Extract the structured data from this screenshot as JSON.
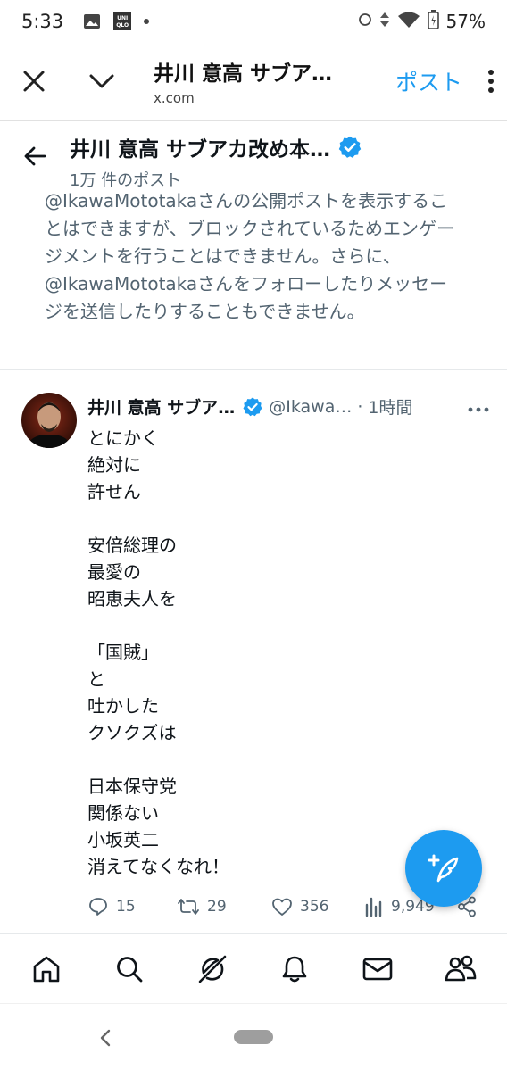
{
  "status_bar": {
    "time": "5:33",
    "uniqlo_label": "UNI QLO",
    "battery_percent": "57%"
  },
  "browser": {
    "title": "井川 意高 サブア…",
    "url": "x.com",
    "post_button": "ポスト"
  },
  "profile": {
    "name": "井川 意高 サブアカ改め本…",
    "post_count": "1万 件のポスト",
    "verified": true
  },
  "notice": "@IkawaMototakaさんの公開ポストを表示することはできますが、ブロックされているためエンゲージメントを行うことはできません。さらに、@IkawaMototakaさんをフォローしたりメッセージを送信したりすることもできません。",
  "post": {
    "name": "井川 意高 サブア…",
    "handle": "@Ikawa…",
    "separator": "·",
    "time": "1時間",
    "text": "とにかく\n絶対に\n許せん\n\n安倍総理の\n最愛の\n昭恵夫人を\n\n「国賊」\nと\n吐かした\nクソクズは\n\n日本保守党\n関係ない\n小坂英二\n消えてなくなれ！",
    "replies": "15",
    "reposts": "29",
    "likes": "356",
    "views": "9,949"
  },
  "colors": {
    "accent": "#1d9bf0",
    "muted": "#536471"
  },
  "icons": {
    "close": "close-icon",
    "chevron": "chevron-down-icon",
    "back": "arrow-left-icon",
    "verified": "verified-badge-icon",
    "compose": "compose-feather-icon"
  }
}
